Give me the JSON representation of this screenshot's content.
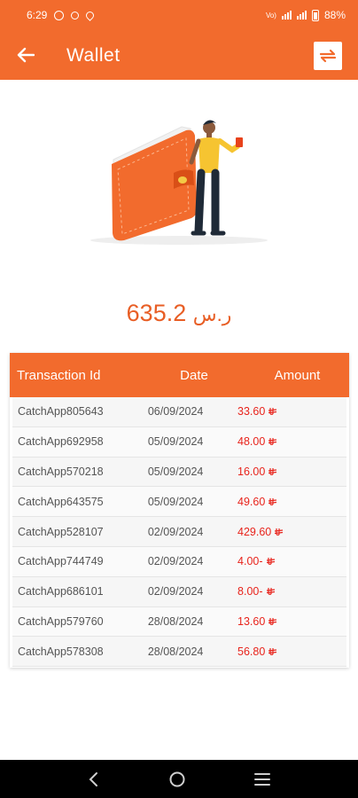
{
  "status_bar": {
    "time": "6:29",
    "network_label": "Vo)",
    "battery": "88%"
  },
  "app_bar": {
    "title": "Wallet"
  },
  "balance": {
    "amount": "635.2",
    "currency_symbol": "ر.س"
  },
  "table": {
    "headers": {
      "id": "Transaction Id",
      "date": "Date",
      "amount": "Amount"
    },
    "rows": [
      {
        "id": "CatchApp805643",
        "date": "06/09/2024",
        "amount": "33.60"
      },
      {
        "id": "CatchApp692958",
        "date": "05/09/2024",
        "amount": "48.00"
      },
      {
        "id": "CatchApp570218",
        "date": "05/09/2024",
        "amount": "16.00"
      },
      {
        "id": "CatchApp643575",
        "date": "05/09/2024",
        "amount": "49.60"
      },
      {
        "id": "CatchApp528107",
        "date": "02/09/2024",
        "amount": "429.60"
      },
      {
        "id": "CatchApp744749",
        "date": "02/09/2024",
        "amount": "4.00-"
      },
      {
        "id": "CatchApp686101",
        "date": "02/09/2024",
        "amount": "8.00-"
      },
      {
        "id": "CatchApp579760",
        "date": "28/08/2024",
        "amount": "13.60"
      },
      {
        "id": "CatchApp578308",
        "date": "28/08/2024",
        "amount": "56.80"
      }
    ]
  },
  "icons": {
    "back": "arrow-left-icon",
    "swap": "swap-arrows-icon",
    "currency": "riyal-icon",
    "nav_back": "chevron-left-icon",
    "nav_home": "circle-home-icon",
    "nav_recents": "menu-lines-icon"
  },
  "colors": {
    "brand": "#f26b2d",
    "balance_text": "#e85e25",
    "amount_text": "#e8231b"
  }
}
